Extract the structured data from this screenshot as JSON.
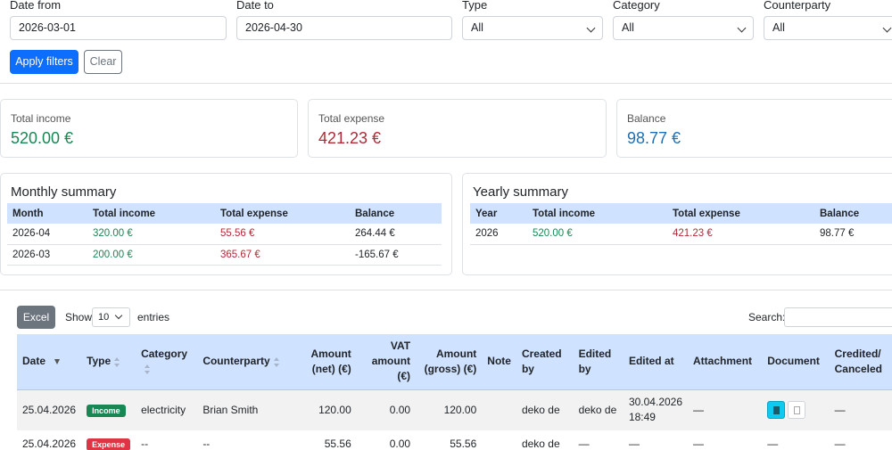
{
  "filters": {
    "date_from_label": "Date from",
    "date_from_value": "2026-03-01",
    "date_to_label": "Date to",
    "date_to_value": "2026-04-30",
    "type_label": "Type",
    "type_value": "All",
    "category_label": "Category",
    "category_value": "All",
    "counterparty_label": "Counterparty",
    "counterparty_value": "All",
    "apply_label": "Apply filters",
    "clear_label": "Clear"
  },
  "stats": {
    "income_label": "Total income",
    "income_value": "520.00 €",
    "expense_label": "Total expense",
    "expense_value": "421.23 €",
    "balance_label": "Balance",
    "balance_value": "98.77 €"
  },
  "monthly": {
    "title": "Monthly summary",
    "headers": [
      "Month",
      "Total income",
      "Total expense",
      "Balance"
    ],
    "rows": [
      [
        "2026-04",
        "320.00 €",
        "55.56 €",
        "264.44 €"
      ],
      [
        "2026-03",
        "200.00 €",
        "365.67 €",
        "-165.67 €"
      ]
    ]
  },
  "yearly": {
    "title": "Yearly summary",
    "headers": [
      "Year",
      "Total income",
      "Total expense",
      "Balance"
    ],
    "rows": [
      [
        "2026",
        "520.00 €",
        "421.23 €",
        "98.77 €"
      ]
    ]
  },
  "table_controls": {
    "excel_label": "Excel",
    "show_label": "Show",
    "entries_value": "10",
    "entries_label": "entries",
    "search_label": "Search:"
  },
  "table": {
    "headers": {
      "date": "Date",
      "type": "Type",
      "category": "Category",
      "counterparty": "Counterparty",
      "amount_net_1": "Amount",
      "amount_net_2": "(net) (€)",
      "vat_1": "VAT",
      "vat_2": "amount",
      "vat_3": "(€)",
      "amount_gross_1": "Amount",
      "amount_gross_2": "(gross) (€)",
      "note": "Note",
      "created_1": "Created",
      "created_2": "by",
      "edited_1": "Edited",
      "edited_2": "by",
      "edited_at": "Edited at",
      "attachment": "Attachment",
      "document": "Document",
      "credited_1": "Credited/",
      "credited_2": "Canceled"
    },
    "rows": [
      {
        "date": "25.04.2026",
        "type": "Income",
        "category": "electricity",
        "counterparty": "Brian Smith",
        "amount_net": "120.00",
        "vat": "0.00",
        "amount_gross": "120.00",
        "note": "",
        "created_by": "deko de",
        "edited_by": "deko de",
        "edited_at_1": "30.04.2026",
        "edited_at_2": "18:49",
        "attachment": "—",
        "credited": "—"
      },
      {
        "date": "25.04.2026",
        "type": "Expense",
        "category": "--",
        "counterparty": "--",
        "amount_net": "55.56",
        "vat": "0.00",
        "amount_gross": "55.56",
        "note": "",
        "created_by": "deko de",
        "edited_by": "—",
        "edited_at_1": "—",
        "attachment": "—",
        "document": "—",
        "credited": "—"
      }
    ]
  },
  "colors": {
    "primary": "#0d6efd",
    "income": "#198754",
    "expense": "#b02a37",
    "balance": "#1f6fb2",
    "table_header": "#cfe2ff"
  }
}
